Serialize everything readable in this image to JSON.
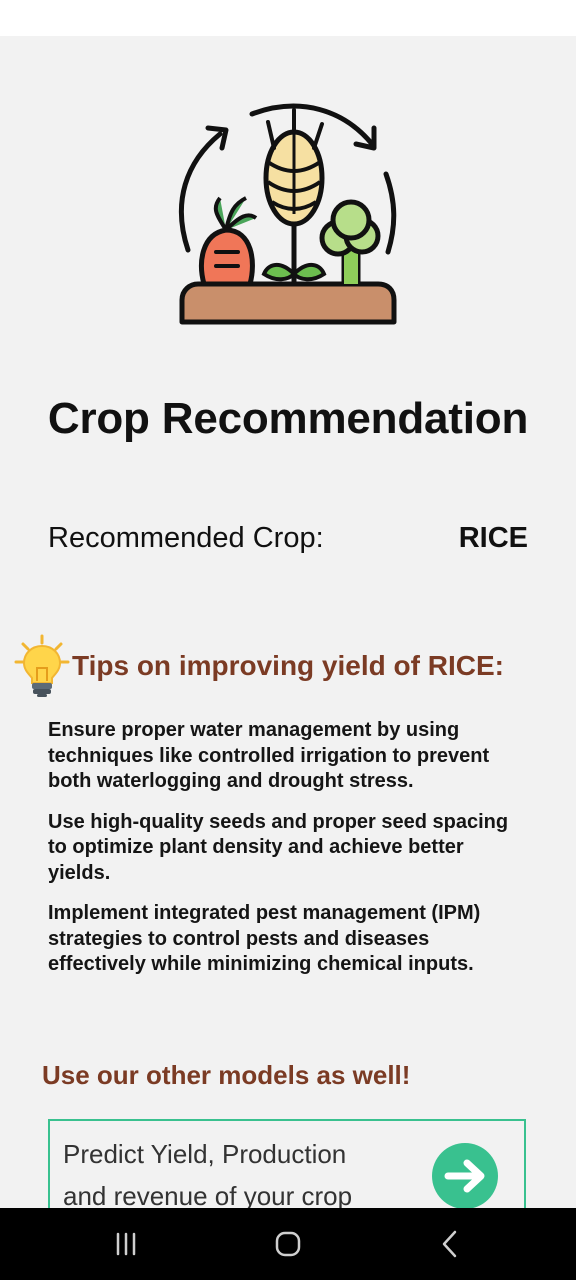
{
  "page": {
    "title": "Crop Recommendation"
  },
  "hero": {
    "icon": "crop-rotation-icon"
  },
  "recommendation": {
    "label": "Recommended Crop:",
    "value": "RICE"
  },
  "tips": {
    "icon": "lightbulb-icon",
    "heading": "Tips on improving yield of RICE:",
    "items": [
      "Ensure proper water management by using techniques like controlled irrigation to prevent both waterlogging and drought stress.",
      "Use high-quality seeds and proper seed spacing to optimize plant density and achieve better yields.",
      "Implement integrated pest management (IPM) strategies to control pests and diseases effectively while minimizing chemical inputs."
    ]
  },
  "other_models": {
    "heading": "Use our other models as well!",
    "card": {
      "text": "Predict Yield, Production and revenue of your crop",
      "button_icon": "arrow-right-icon"
    }
  },
  "navbar": {
    "recents_icon": "recent-apps-icon",
    "home_icon": "home-icon",
    "back_icon": "back-icon"
  },
  "colors": {
    "accent_brown": "#7b3b24",
    "accent_green": "#39c18f",
    "background": "#f2f2f2"
  }
}
